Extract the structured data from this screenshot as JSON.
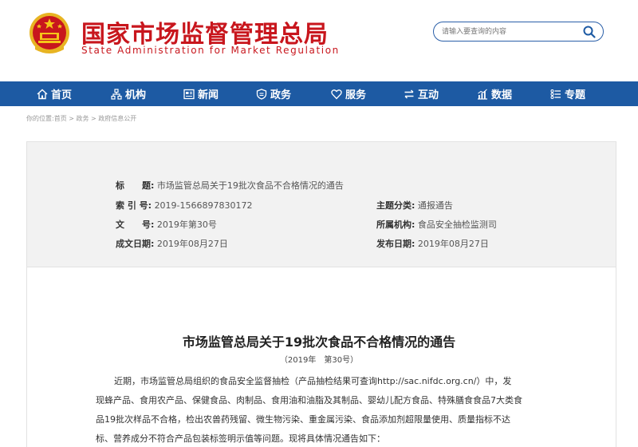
{
  "header": {
    "title_cn": "国家市场监督管理总局",
    "title_en": "State Administration for Market Regulation",
    "search_placeholder": "请输入要查询的内容",
    "emblem_icon": "national-emblem-icon",
    "accent_color": "#c8161d"
  },
  "nav": {
    "color": "#1d5aa3",
    "items": [
      {
        "label": "首页",
        "icon": "home-icon"
      },
      {
        "label": "机构",
        "icon": "org-chart-icon"
      },
      {
        "label": "新闻",
        "icon": "news-icon"
      },
      {
        "label": "政务",
        "icon": "government-icon"
      },
      {
        "label": "服务",
        "icon": "heart-icon"
      },
      {
        "label": "互动",
        "icon": "exchange-icon"
      },
      {
        "label": "数据",
        "icon": "chart-icon"
      },
      {
        "label": "专题",
        "icon": "list-icon"
      }
    ]
  },
  "breadcrumb": {
    "prefix": "你的位置:",
    "home": "首页",
    "sep1": " > ",
    "section": "政务",
    "sep2": " > ",
    "current": "政府信息公开"
  },
  "meta": {
    "title_label": "标　　题:",
    "title_value": "市场监管总局关于19批次食品不合格情况的通告",
    "index_label": "索 引 号:",
    "index_value": "2019-1566897830172",
    "topic_label": "主题分类:",
    "topic_value": "通报通告",
    "doc_label": "文　　号:",
    "doc_value": "2019年第30号",
    "org_label": "所属机构:",
    "org_value": "食品安全抽检监测司",
    "created_label": "成文日期:",
    "created_value": "2019年08月27日",
    "published_label": "发布日期:",
    "published_value": "2019年08月27日"
  },
  "article": {
    "title": "市场监管总局关于19批次食品不合格情况的通告",
    "subtitle": "（2019年　第30号）",
    "lines": [
      "近期，市场监管总局组织的食品安全监督抽检（产品抽检结果可查询http://sac.nifdc.org.cn/）中，发",
      "现蜂产品、食用农产品、保健食品、肉制品、食用油和油脂及其制品、婴幼儿配方食品、特殊膳食食品7大类食",
      "品19批次样品不合格，检出农兽药残留、微生物污染、重金属污染、食品添加剂超限量使用、质量指标不达",
      "标、营养成分不符合产品包装标签明示值等问题。现将具体情况通告如下："
    ]
  }
}
